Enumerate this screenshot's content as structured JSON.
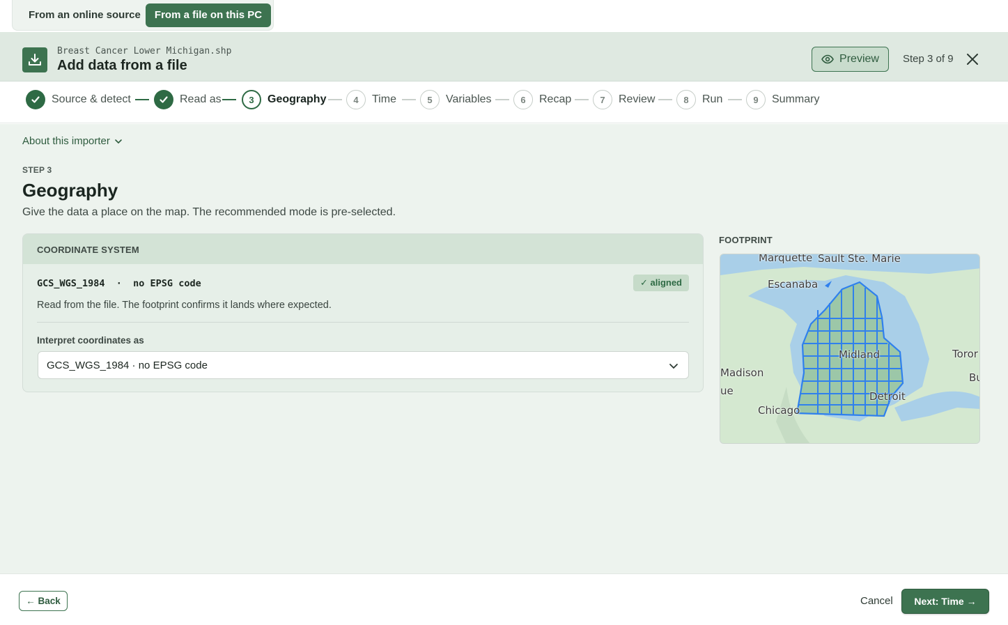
{
  "source_tabs": {
    "online": "From an online source",
    "file": "From a file on this PC",
    "active": "file"
  },
  "header": {
    "filename": "Breast Cancer Lower Michigan.shp",
    "title": "Add data from a file",
    "preview_label": "Preview",
    "step_count": "Step 3 of 9",
    "icon": "download-icon"
  },
  "stepper": {
    "steps": [
      {
        "num": "1",
        "label": "Source & detect",
        "state": "done"
      },
      {
        "num": "2",
        "label": "Read as",
        "state": "done"
      },
      {
        "num": "3",
        "label": "Geography",
        "state": "current"
      },
      {
        "num": "4",
        "label": "Time",
        "state": "future"
      },
      {
        "num": "5",
        "label": "Variables",
        "state": "future"
      },
      {
        "num": "6",
        "label": "Recap",
        "state": "future"
      },
      {
        "num": "7",
        "label": "Review",
        "state": "future"
      },
      {
        "num": "8",
        "label": "Run",
        "state": "future"
      },
      {
        "num": "9",
        "label": "Summary",
        "state": "future"
      }
    ]
  },
  "main": {
    "about": "About this importer",
    "kicker": "STEP 3",
    "title": "Geography",
    "subtitle": "Give the data a place on the map. The recommended mode is pre-selected."
  },
  "crs_card": {
    "heading": "COORDINATE SYSTEM",
    "crs_line": "GCS_WGS_1984  ·  no EPSG code",
    "badge": "✓ aligned",
    "description": "Read from the file. The footprint confirms it lands where expected.",
    "interpret_label": "Interpret coordinates as",
    "selected_value": "GCS_WGS_1984 · no EPSG code"
  },
  "footprint": {
    "label": "FOOTPRINT",
    "places": [
      "Marquette",
      "Sault Ste. Marie",
      "Escanaba",
      "Midland",
      "Toror",
      "Bu",
      "Madison",
      "ue",
      "Detroit",
      "Chicago"
    ]
  },
  "footer": {
    "back": "← Back",
    "cancel": "Cancel",
    "next": "Next: Time →"
  },
  "colors": {
    "accent": "#3d7350",
    "header_bg": "#dfe9e1",
    "main_bg": "#edf3ee",
    "county_outline": "#2f80ed"
  }
}
